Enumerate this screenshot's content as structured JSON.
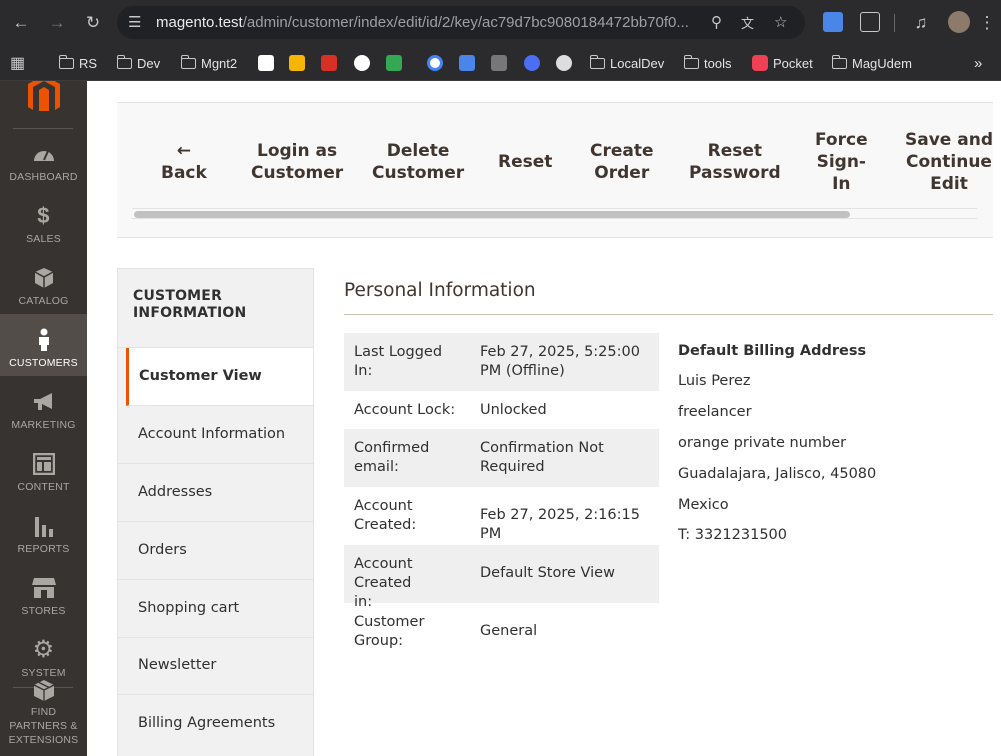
{
  "browser": {
    "url_host": "magento.test",
    "url_path": "/admin/customer/index/edit/id/2/key/ac79d7bc9080184472bb70f0...",
    "bookmarks": [
      "RS",
      "Dev",
      "Mgnt2",
      "LocalDev",
      "tools",
      "Pocket",
      "MagUdem"
    ]
  },
  "sidebar": {
    "items": [
      {
        "label": "DASHBOARD",
        "icon": "dashboard-icon"
      },
      {
        "label": "SALES",
        "icon": "dollar-icon"
      },
      {
        "label": "CATALOG",
        "icon": "box-icon"
      },
      {
        "label": "CUSTOMERS",
        "icon": "person-icon",
        "active": true
      },
      {
        "label": "MARKETING",
        "icon": "megaphone-icon"
      },
      {
        "label": "CONTENT",
        "icon": "layout-icon"
      },
      {
        "label": "REPORTS",
        "icon": "bar-chart-icon"
      },
      {
        "label": "STORES",
        "icon": "store-icon"
      },
      {
        "label": "SYSTEM",
        "icon": "gear-icon"
      },
      {
        "label": "FIND PARTNERS & EXTENSIONS",
        "icon": "blocks-icon"
      }
    ]
  },
  "actions": {
    "back": "← Back",
    "back_arrow": "←",
    "back_label": "Back",
    "login_as_customer": [
      "Login as",
      "Customer"
    ],
    "delete_customer": [
      "Delete",
      "Customer"
    ],
    "reset": "Reset",
    "create_order": [
      "Create",
      "Order"
    ],
    "reset_password": [
      "Reset",
      "Password"
    ],
    "force_sign_in": [
      "Force",
      "Sign-",
      "In"
    ],
    "save_continue": [
      "Save and",
      "Continue",
      "Edit"
    ]
  },
  "tabs": {
    "title": [
      "CUSTOMER",
      "INFORMATION"
    ],
    "items": [
      "Customer View",
      "Account Information",
      "Addresses",
      "Orders",
      "Shopping cart",
      "Newsletter",
      "Billing Agreements"
    ]
  },
  "personal_info": {
    "title": "Personal Information",
    "rows": [
      {
        "label": "Last Logged In:",
        "value": "Feb 27, 2025, 5:25:00 PM (Offline)"
      },
      {
        "label": "Account Lock:",
        "value": "Unlocked"
      },
      {
        "label": "Confirmed email:",
        "value": "Confirmation Not Required"
      },
      {
        "label": "Account Created:",
        "value": "Feb 27, 2025, 2:16:15 PM"
      },
      {
        "label": "Account Created in:",
        "value": "Default Store View"
      },
      {
        "label": "Customer Group:",
        "value": "General"
      }
    ]
  },
  "billing_address": {
    "title": "Default Billing Address",
    "lines": [
      "Luis Perez",
      "freelancer",
      "orange private number",
      "Guadalajara, Jalisco, 45080",
      "Mexico",
      "T: 3321231500"
    ]
  },
  "colors": {
    "accent": "#eb5202",
    "sidebar_bg": "#373330",
    "sidebar_active": "#524d49"
  }
}
